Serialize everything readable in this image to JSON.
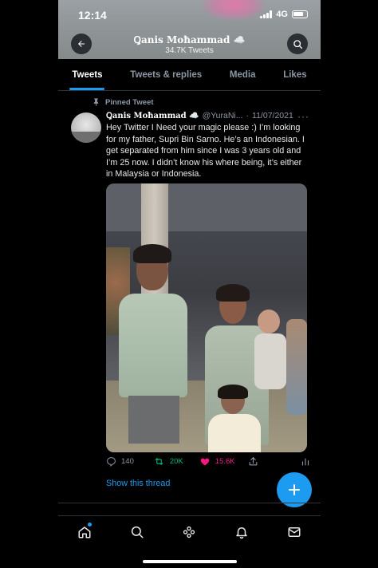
{
  "status_bar": {
    "time": "12:14",
    "network": "4G"
  },
  "profile_header": {
    "name": "Ꝗanis Moħammad ☁️",
    "tweet_count": "34.7K Tweets"
  },
  "tabs": [
    {
      "label": "Tweets",
      "active": true
    },
    {
      "label": "Tweets & replies",
      "active": false
    },
    {
      "label": "Media",
      "active": false
    },
    {
      "label": "Likes",
      "active": false
    }
  ],
  "tweet": {
    "pinned_label": "Pinned Tweet",
    "author_name": "Ꝗanis Moħammad ☁️",
    "handle": "@YuraNi...",
    "separator": "·",
    "date": "11/07/2021",
    "text": "Hey Twitter I Need your magic please :) I’m looking for my father, Supri Bin Sarno. He’s an Indonesian. I get separated from him since I was 3 years old and I’m 25 now. I didn’t know his where being, it’s either in Malaysia or Indonesia.",
    "replies": "140",
    "retweets": "20K",
    "likes": "15.6K",
    "show_thread": "Show this thread"
  },
  "icons": {
    "back": "arrow-left-icon",
    "search": "search-icon",
    "pin": "pin-icon",
    "more": "more-horizontal-icon",
    "reply": "reply-icon",
    "retweet": "retweet-icon",
    "like": "heart-icon",
    "share": "share-icon",
    "stats": "stats-icon",
    "compose": "plus-icon",
    "home": "home-icon",
    "explore": "search-icon",
    "spaces": "spaces-icon",
    "notifications": "bell-icon",
    "messages": "envelope-icon"
  },
  "colors": {
    "accent": "#1d9bf0",
    "retweet": "#00ba7c",
    "like": "#f91880",
    "background": "#000000",
    "secondary_text": "#8b98a5"
  }
}
